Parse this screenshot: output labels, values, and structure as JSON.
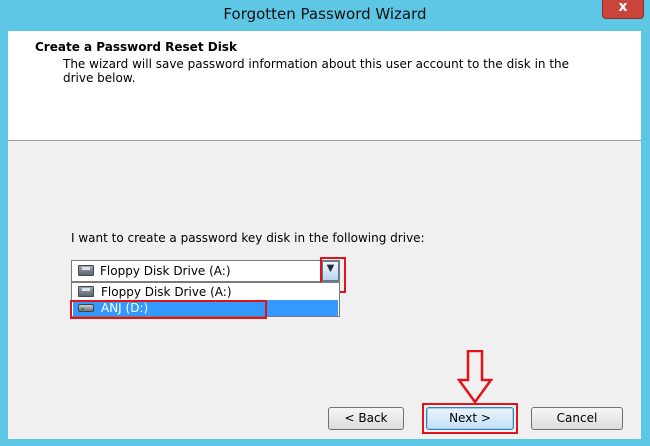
{
  "window": {
    "title": "Forgotten Password Wizard",
    "close_symbol": "x"
  },
  "header": {
    "title": "Create a Password Reset Disk",
    "description": "The wizard will save password information about this user account to the disk in the drive below."
  },
  "main": {
    "prompt": "I want to create a password key disk in the following drive:",
    "drive_select": {
      "selected": "Floppy Disk Drive (A:)",
      "arrow_symbol": "▼",
      "options": [
        {
          "label": "Floppy Disk Drive (A:)",
          "icon": "floppy-drive-icon",
          "highlighted": false
        },
        {
          "label": "ANJ (D:)",
          "icon": "hard-drive-icon",
          "highlighted": true
        }
      ]
    }
  },
  "buttons": {
    "back": "< Back",
    "next": "Next >",
    "cancel": "Cancel"
  },
  "annotations": {
    "color": "#e0121a",
    "arrow": "down-arrow-outline"
  },
  "colors": {
    "frame": "#5fc7e6",
    "selection": "#3399ff",
    "close_button": "#c9453b"
  }
}
